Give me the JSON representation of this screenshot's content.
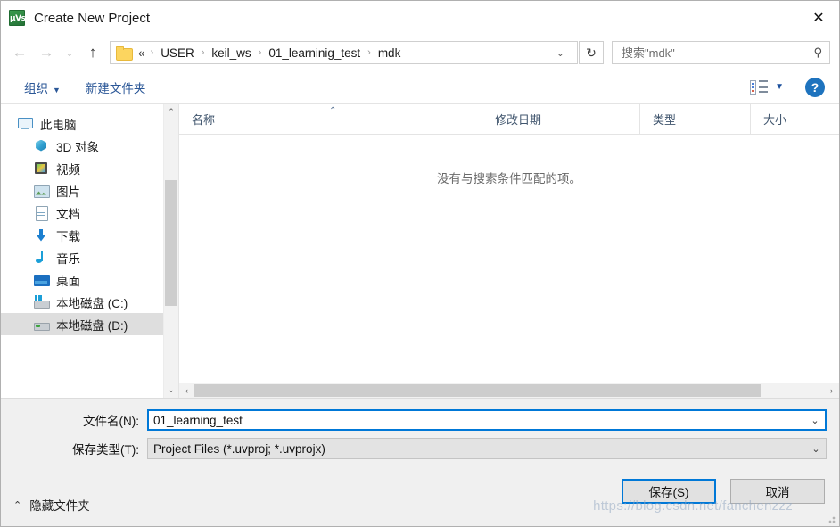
{
  "window": {
    "title": "Create New Project",
    "app_icon": "keil-uvision-icon",
    "close_label": "✕"
  },
  "nav": {
    "back": "←",
    "forward": "→",
    "recent": "⌄",
    "up": "↑",
    "refresh": "↻",
    "address_chevron": "⌄",
    "breadcrumb_lead": "«",
    "separator": "›",
    "breadcrumbs": [
      "USER",
      "keil_ws",
      "01_learninig_test",
      "mdk"
    ]
  },
  "search": {
    "placeholder": "搜索\"mdk\"",
    "value": "",
    "icon": "search-icon"
  },
  "toolbar": {
    "organize_label": "组织",
    "organize_caret": "▼",
    "new_folder_label": "新建文件夹",
    "view_caret": "▼",
    "help_label": "?"
  },
  "sidebar": {
    "items": [
      {
        "label": "此电脑",
        "icon": "computer-icon",
        "indent": false,
        "selected": false
      },
      {
        "label": "3D 对象",
        "icon": "3d-objects-icon",
        "indent": true,
        "selected": false
      },
      {
        "label": "视频",
        "icon": "videos-icon",
        "indent": true,
        "selected": false
      },
      {
        "label": "图片",
        "icon": "pictures-icon",
        "indent": true,
        "selected": false
      },
      {
        "label": "文档",
        "icon": "documents-icon",
        "indent": true,
        "selected": false
      },
      {
        "label": "下载",
        "icon": "downloads-icon",
        "indent": true,
        "selected": false
      },
      {
        "label": "音乐",
        "icon": "music-icon",
        "indent": true,
        "selected": false
      },
      {
        "label": "桌面",
        "icon": "desktop-icon",
        "indent": true,
        "selected": false
      },
      {
        "label": "本地磁盘 (C:)",
        "icon": "local-disk-c-icon",
        "indent": true,
        "selected": false
      },
      {
        "label": "本地磁盘 (D:)",
        "icon": "local-disk-d-icon",
        "indent": true,
        "selected": true
      }
    ],
    "scroll_up": "⌃",
    "scroll_down": "⌄"
  },
  "filelist": {
    "columns": [
      {
        "label": "名称",
        "key": "name"
      },
      {
        "label": "修改日期",
        "key": "date"
      },
      {
        "label": "类型",
        "key": "type"
      },
      {
        "label": "大小",
        "key": "size"
      }
    ],
    "sort_arrow": "⌃",
    "rows": [],
    "empty_message": "没有与搜索条件匹配的项。",
    "hscroll_left": "‹",
    "hscroll_right": "›"
  },
  "form": {
    "filename_label": "文件名(N):",
    "filename_value": "01_learning_test",
    "filetype_label": "保存类型(T):",
    "filetype_value": "Project Files (*.uvproj; *.uvprojx)",
    "chevron": "⌄"
  },
  "buttons": {
    "save": "保存(S)",
    "cancel": "取消"
  },
  "footer": {
    "hide_folders_label": "隐藏文件夹",
    "hide_folders_chevron": "⌃"
  },
  "watermark": {
    "text": "https://blog.csdn.net/fanchenzzz"
  },
  "colors": {
    "accent": "#0078d7",
    "link": "#2b5797",
    "selection": "#dedede",
    "help_blue": "#1e73be"
  }
}
